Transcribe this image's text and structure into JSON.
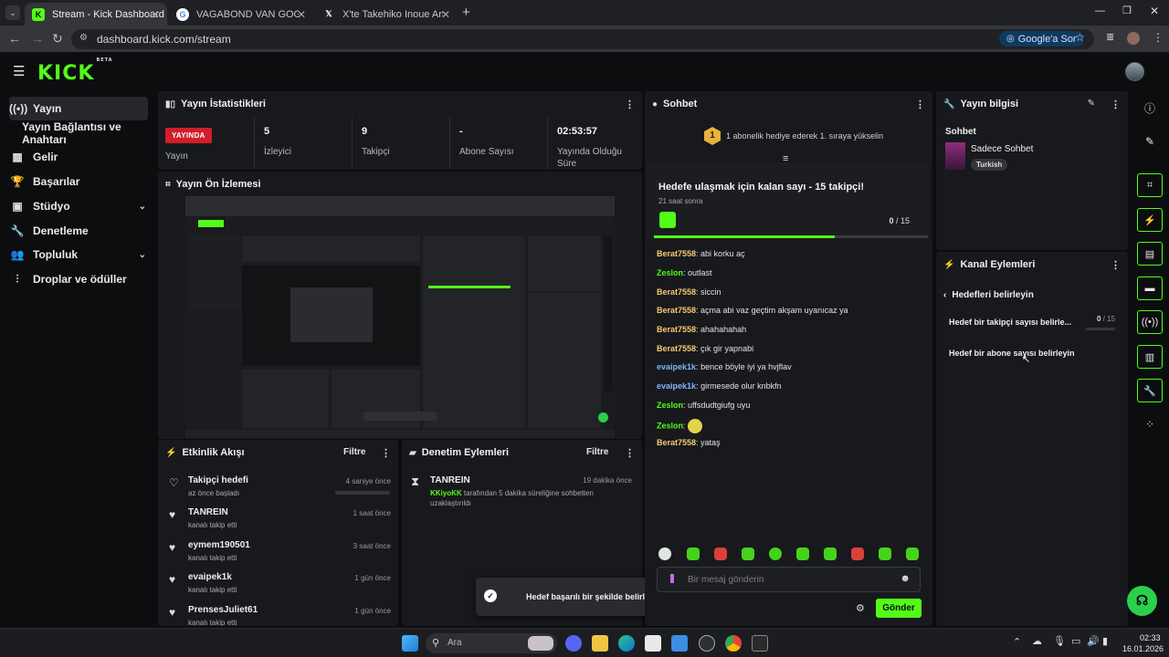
{
  "browser": {
    "tabs": [
      {
        "title": "Stream - Kick Dashboard",
        "active": true
      },
      {
        "title": "VAGABOND VAN GOGH - Goog",
        "active": false
      },
      {
        "title": "X'te Takehiko Inoue Art: \"Vagab",
        "active": false
      }
    ],
    "url": "dashboard.kick.com/stream",
    "google_button": "Google'a Sor"
  },
  "brand": {
    "logo": "KICK",
    "badge": "BETA",
    "accent": "#53fc18"
  },
  "sidebar": {
    "items": [
      {
        "label": "Yayın",
        "icon": "broadcast-icon",
        "active": true
      },
      {
        "label": "Yayın Bağlantısı ve Anahtarı",
        "icon": "",
        "active": false
      },
      {
        "label": "Gelir",
        "icon": "revenue-icon",
        "active": false
      },
      {
        "label": "Başarılar",
        "icon": "trophy-icon",
        "active": false
      },
      {
        "label": "Stüdyo",
        "icon": "studio-icon",
        "active": false
      },
      {
        "label": "Denetleme",
        "icon": "wrench-icon",
        "active": false
      },
      {
        "label": "Topluluk",
        "icon": "community-icon",
        "active": false
      },
      {
        "label": "Droplar ve ödüller",
        "icon": "drops-icon",
        "active": false
      }
    ]
  },
  "stats": {
    "title": "Yayın İstatistikleri",
    "live_badge": "YAYINDA",
    "stream_label": "Yayın",
    "viewers_value": "5",
    "viewers_label": "İzleyici",
    "followers_value": "9",
    "followers_label": "Takipçi",
    "subs_value": "-",
    "subs_label": "Abone Sayısı",
    "uptime_value": "02:53:57",
    "uptime_label": "Yayında Olduğu Süre"
  },
  "preview": {
    "title": "Yayın Ön İzlemesi"
  },
  "activity": {
    "title": "Etkinlik Akışı",
    "filter": "Filtre",
    "rows": [
      {
        "name": "Takipçi hedefi",
        "sub": "az önce başladı",
        "time": "4 saniye önce",
        "icon": "heart-outline-icon"
      },
      {
        "name": "TANREIN",
        "sub": "kanalı takip etti",
        "time": "1 saat önce",
        "icon": "heart-icon"
      },
      {
        "name": "eymem190501",
        "sub": "kanalı takip etti",
        "time": "3 saat önce",
        "icon": "heart-icon"
      },
      {
        "name": "evaipek1k",
        "sub": "kanalı takip etti",
        "time": "1 gün önce",
        "icon": "heart-icon"
      },
      {
        "name": "PrensesJuliet61",
        "sub": "kanalı takip etti",
        "time": "1 gün önce",
        "icon": "heart-icon"
      }
    ]
  },
  "moderation": {
    "title": "Denetim Eylemleri",
    "filter": "Filtre",
    "entry": {
      "name": "TANREIN",
      "time": "19 dakika önce",
      "actor": "KKiyoKK",
      "text": "tarafından 5 dakika süreliğine sohbetten uzaklaştırıldı"
    }
  },
  "toast": {
    "text": "Hedef başarılı bir şekilde belirlendi!"
  },
  "chat": {
    "title": "Sohbet",
    "promo_rank": "1",
    "promo_text": "1 abonelik hediye ederek 1. sıraya yükselin",
    "goal_title": "Hedefe ulaşmak için kalan sayı - 15 takipçi!",
    "goal_time": "21 saat sonra",
    "goal_current": "0",
    "goal_total": "/ 15",
    "messages": [
      {
        "user": "Berat7558",
        "color": "#f7c873",
        "text": "abi korku aç"
      },
      {
        "user": "Zeslon",
        "color": "#53fc18",
        "text": "outlast"
      },
      {
        "user": "Berat7558",
        "color": "#f7c873",
        "text": "siccin"
      },
      {
        "user": "Berat7558",
        "color": "#f7c873",
        "text": "açma abi vaz geçtim akşam uyanıcaz ya"
      },
      {
        "user": "Berat7558",
        "color": "#f7c873",
        "text": "ahahahahah"
      },
      {
        "user": "Berat7558",
        "color": "#f7c873",
        "text": "çık gir yapnabi"
      },
      {
        "user": "evaipek1k",
        "color": "#7fb3ff",
        "text": "bence böyle iyi ya hvjflav"
      },
      {
        "user": "evaipek1k",
        "color": "#7fb3ff",
        "text": "girmesede olur knbkfn"
      },
      {
        "user": "Zeslon",
        "color": "#53fc18",
        "text": "uffsdudtgiufg uyu"
      },
      {
        "user": "Zeslon",
        "color": "#53fc18",
        "text": ""
      },
      {
        "user": "Berat7558",
        "color": "#f7c873",
        "text": "yataş"
      }
    ],
    "input_placeholder": "Bir mesaj gönderin",
    "send_label": "Gönder"
  },
  "stream_info": {
    "title": "Yayın bilgisi",
    "section": "Sohbet",
    "category": "Sadece Sohbet",
    "language_tag": "Turkish"
  },
  "channel_actions": {
    "title": "Kanal Eylemleri",
    "back_label": "Hedefleri belirleyin",
    "follower_goal": "Hedef bir takipçi sayısı belirle...",
    "follower_current": "0",
    "follower_total": "/ 15",
    "sub_goal": "Hedef bir abone sayısı belirleyin"
  },
  "taskbar": {
    "search_placeholder": "Ara",
    "time": "02:33",
    "date": "16.01.2026"
  }
}
